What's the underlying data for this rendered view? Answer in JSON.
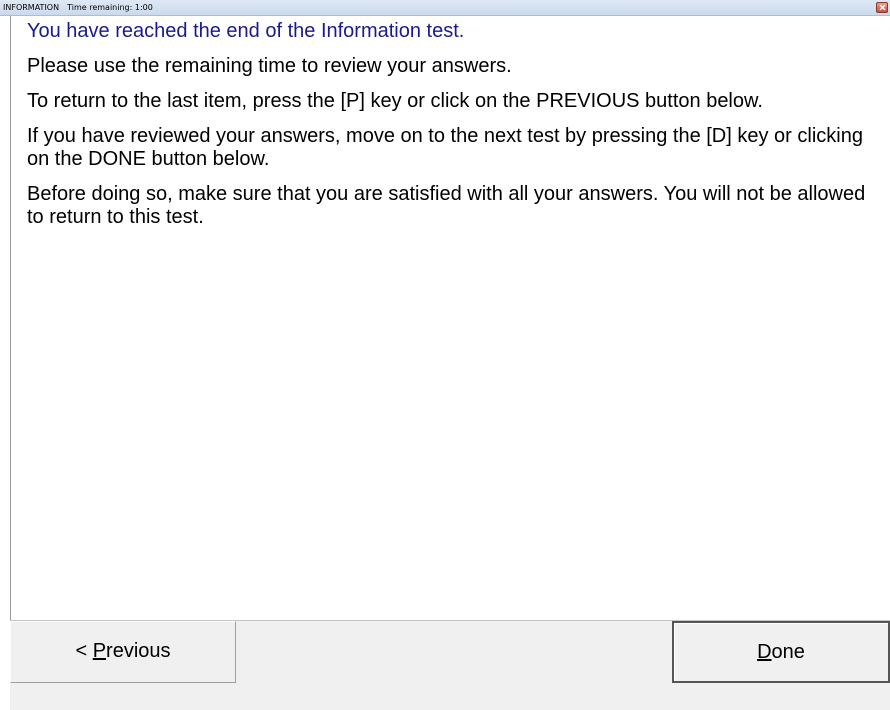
{
  "title_bar": {
    "test_name": "INFORMATION",
    "time_remaining": "Time remaining: 1:00"
  },
  "content": {
    "heading": "You have reached the end of the Information test.",
    "paragraphs": [
      "Please use the remaining time to review your answers.",
      "To return to the last item, press the [P] key or click on the PREVIOUS button below.",
      "If you have reviewed your answers, move on to the next test by pressing the [D] key or clicking on the DONE button below.",
      "Before doing so, make sure that you are satisfied with all your answers. You will not be allowed to return to this test."
    ]
  },
  "buttons": {
    "previous": {
      "prefix": "< ",
      "mnemonic": "P",
      "rest": "revious"
    },
    "done": {
      "mnemonic": "D",
      "rest": "one"
    }
  },
  "colors": {
    "heading": "#1a1a8c",
    "close_button": "#c7503c"
  },
  "icons": {
    "close": "close-icon"
  }
}
